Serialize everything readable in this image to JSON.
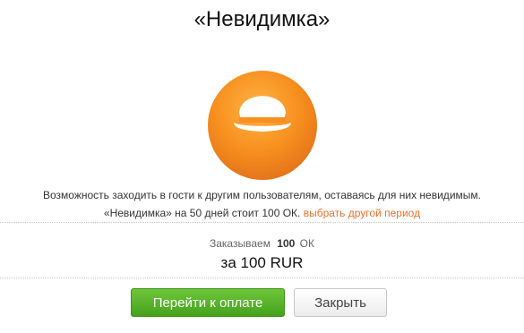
{
  "dialog": {
    "title": "«Невидимка»",
    "icon": "hat-icon",
    "colors": {
      "badge_orange": "#f58a1f",
      "link_orange": "#eb722e",
      "pay_green": "#52ad27"
    },
    "description": {
      "line1": "Возможность заходить в гости к другим пользователям, оставаясь для них невидимым.",
      "line2": "«Невидимка» на 50 дней стоит 100 ОК.",
      "change_period_link": "выбрать другой период"
    },
    "order": {
      "label": "Заказываем",
      "amount": "100",
      "unit": "ОК"
    },
    "price_text": "за 100 RUR",
    "buttons": {
      "pay": "Перейти к оплате",
      "close": "Закрыть"
    }
  }
}
